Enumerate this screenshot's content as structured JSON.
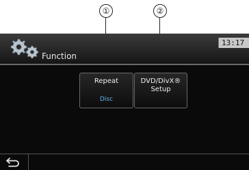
{
  "callouts": [
    "①",
    "②"
  ],
  "header": {
    "title": "Function",
    "time": "13:17"
  },
  "items": [
    {
      "label": "Repeat",
      "value": "Disc"
    },
    {
      "label_line1": "DVD/DivX®",
      "label_line2": "Setup"
    }
  ],
  "icons": {
    "header": "gear-icon",
    "footer": "back-arrow-icon"
  },
  "colors": {
    "value_text": "#5fb6e8",
    "screen_bg": "#0a0a0a"
  }
}
